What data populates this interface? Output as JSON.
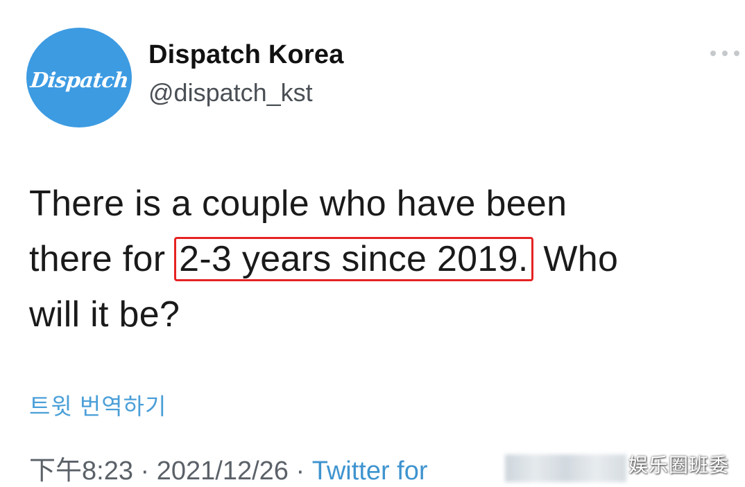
{
  "account": {
    "avatar_text": "Dispatch",
    "avatar_small_text": "",
    "display_name": "Dispatch Korea",
    "handle": "@dispatch_kst"
  },
  "menu": {
    "icon": "more-horizontal-icon"
  },
  "tweet": {
    "line1": "There is a couple who have been",
    "line2_prefix": "there for ",
    "line2_highlight": "2-3 years since 2019.",
    "line2_suffix": " Who",
    "line3": "will it be?"
  },
  "translate_label": "트윗 번역하기",
  "meta": {
    "time": "下午8:23",
    "separator": " · ",
    "date": "2021/12/26",
    "separator2": " · ",
    "source": "Twitter for "
  },
  "watermark": "娱乐圈班委",
  "colors": {
    "avatar_bg": "#3d9be2",
    "highlight_border": "#e62222",
    "link": "#4a9fd8"
  }
}
